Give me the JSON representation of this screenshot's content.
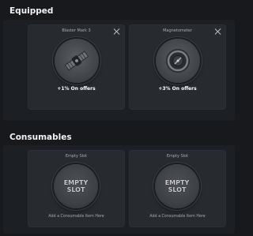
{
  "equipped": {
    "title": "Equipped",
    "slots": [
      {
        "name": "Blaster Mark 3",
        "perk": "+1% On offers",
        "icon": "satellite-icon"
      },
      {
        "name": "Magnetometer",
        "perk": "+3% On offers",
        "icon": "magnetometer-icon"
      }
    ]
  },
  "consumables": {
    "title": "Consumables",
    "slots": [
      {
        "name": "Empty Slot",
        "badge": "EMPTY\nSLOT",
        "hint": "Add a Consumable Item Here"
      },
      {
        "name": "Empty Slot",
        "badge": "EMPTY\nSLOT",
        "hint": "Add a Consumable Item Here"
      }
    ]
  }
}
